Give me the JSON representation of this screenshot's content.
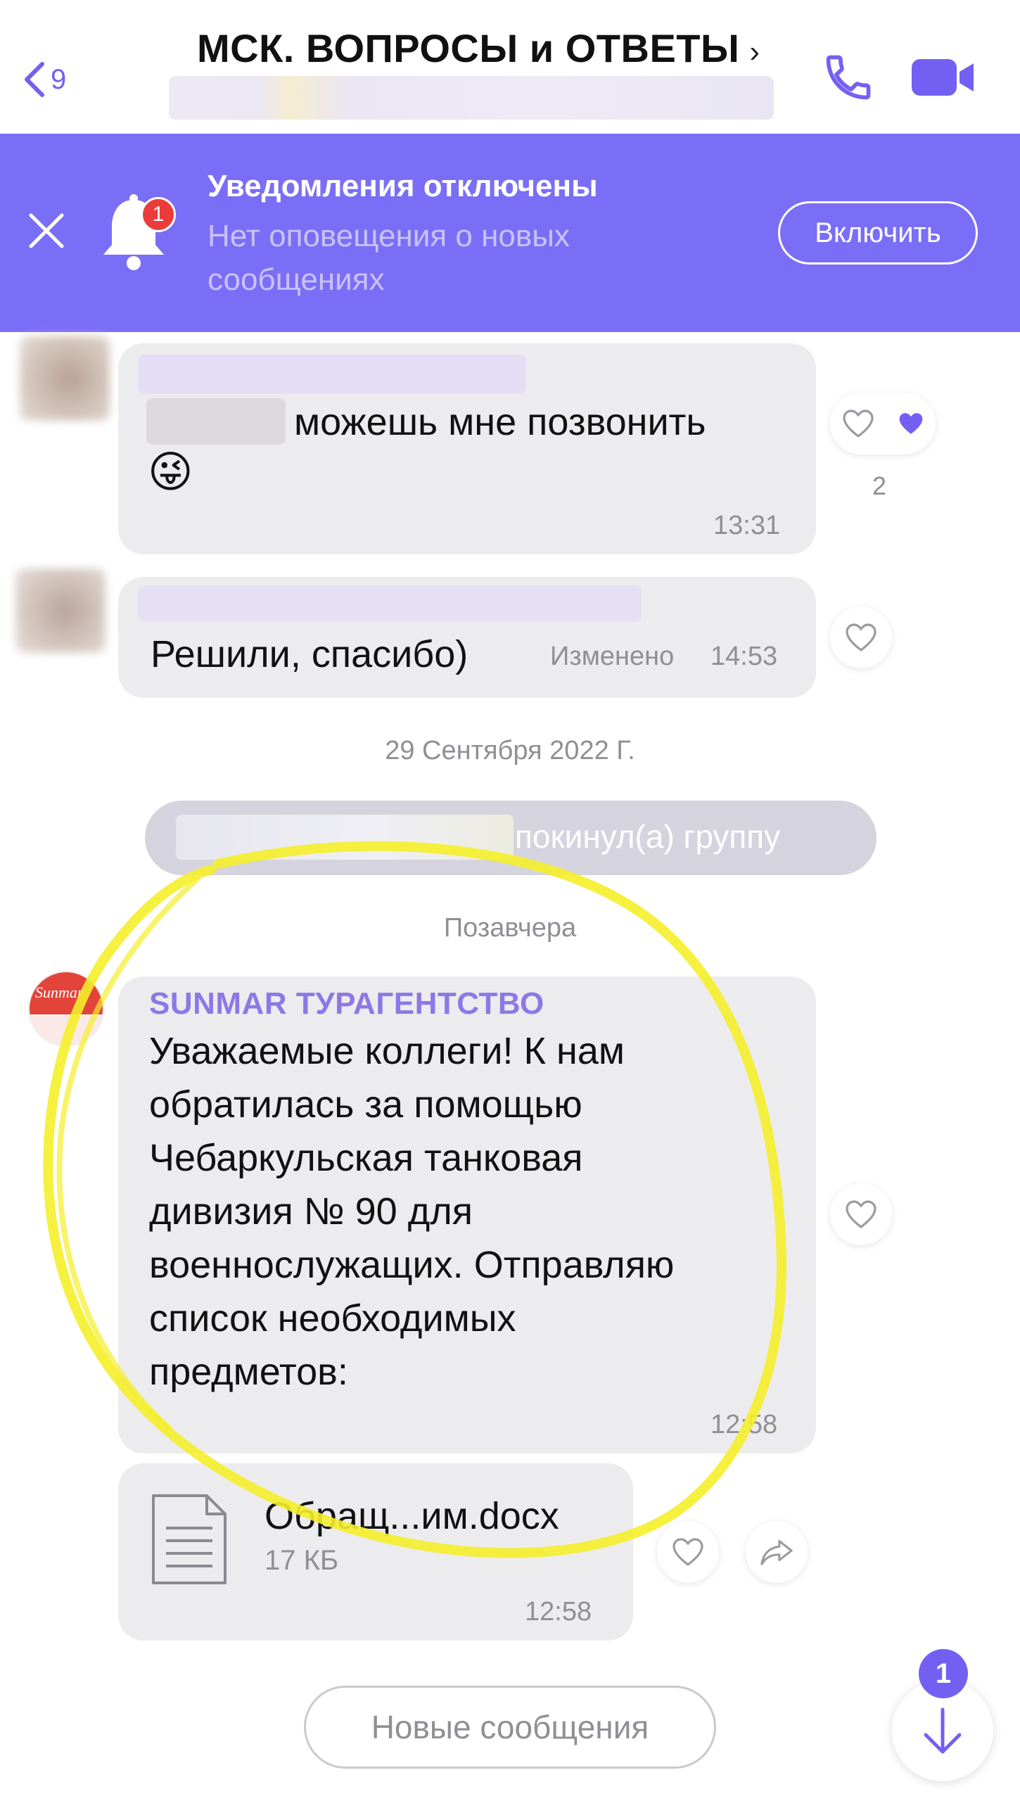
{
  "header": {
    "back_count": "9",
    "title": "МСК. ВОПРОСЫ и ОТВЕТЫ",
    "title_chevron": "›",
    "icons": {
      "back": "chevron-left-icon",
      "call": "phone-icon",
      "video": "video-camera-icon"
    }
  },
  "banner": {
    "title": "Уведомления отключены",
    "subtitle": "Нет оповещения о новых сообщениях",
    "badge_count": "1",
    "enable_button": "Включить",
    "background": "#7b6ef6"
  },
  "messages": [
    {
      "text": "можешь мне позвонить",
      "emoji": "😜",
      "time": "13:31",
      "likes": "2"
    },
    {
      "text": "Решили, спасибо)",
      "edited_label": "Изменено",
      "time": "14:53"
    }
  ],
  "date_separator_1": "29 Сентября 2022 Г.",
  "system_message": "покинул(а) группу",
  "date_separator_2": "Позавчера",
  "sunmar_message": {
    "sender": "SUNMAR ТУРАГЕНТСТВО",
    "avatar_text": "Sunmar",
    "lines": [
      "Уважаемые коллеги! К нам",
      "обратилась за помощью",
      "Чебаркульская танковая",
      "дивизия № 90 для",
      "военнослужащих. Отправляю",
      "список необходимых",
      "предметов:"
    ],
    "time": "12:58"
  },
  "file_message": {
    "file_name": "Обращ...им.docx",
    "file_size": "17 КБ",
    "time": "12:58"
  },
  "footer": {
    "new_messages_button": "Новые сообщения",
    "scroll_badge": "1"
  },
  "colors": {
    "accent": "#7360f2",
    "bubble": "#ececee",
    "highlight": "#f5ee2a"
  }
}
